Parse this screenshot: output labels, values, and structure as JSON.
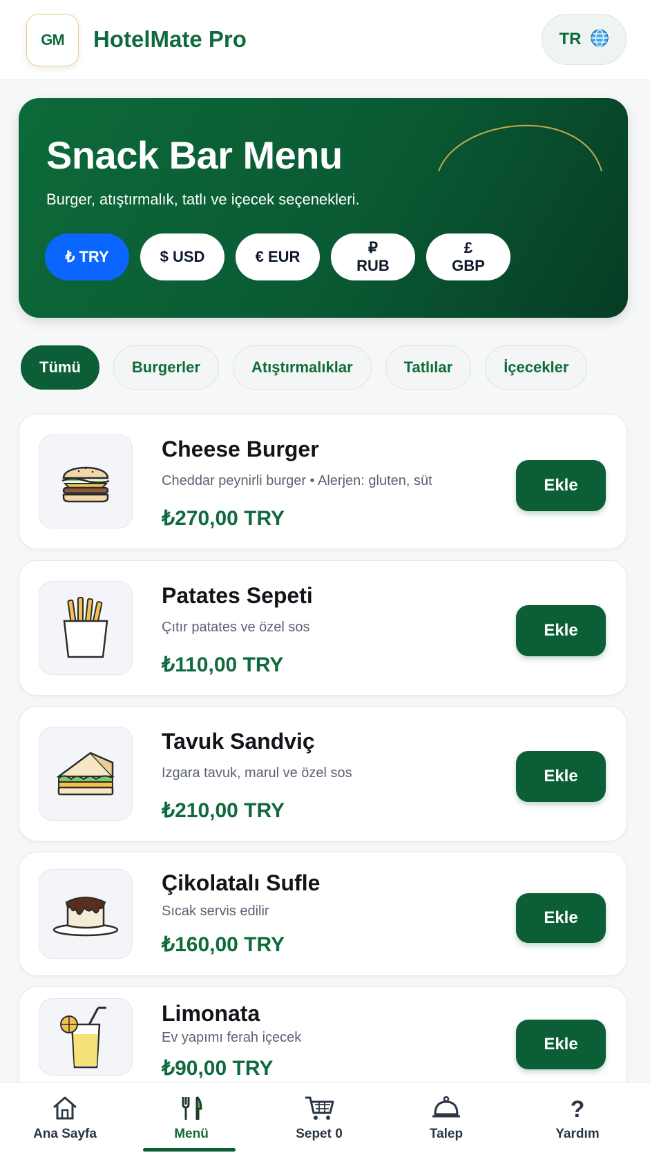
{
  "header": {
    "logo_text": "GM",
    "app_title": "HotelMate Pro",
    "language_code": "TR",
    "language_icon": "globe-icon"
  },
  "hero": {
    "title": "Snack Bar Menu",
    "subtitle": "Burger, atıştırmalık, tatlı ve içecek seçenekleri.",
    "currencies": [
      {
        "label": "₺ TRY",
        "active": true
      },
      {
        "label": "$ USD",
        "active": false
      },
      {
        "label": "€ EUR",
        "active": false
      },
      {
        "label": "₽ RUB",
        "active": false
      },
      {
        "label": "£ GBP",
        "active": false
      }
    ],
    "colors": {
      "background": "#0b5e36",
      "active_currency": "#0a66ff",
      "arc": "#c9a84a"
    }
  },
  "categories": [
    {
      "label": "Tümü",
      "active": true
    },
    {
      "label": "Burgerler",
      "active": false
    },
    {
      "label": "Atıştırmalıklar",
      "active": false
    },
    {
      "label": "Tatlılar",
      "active": false
    },
    {
      "label": "İçecekler",
      "active": false
    }
  ],
  "items": [
    {
      "name": "Cheese Burger",
      "description": "Cheddar peynirli burger • Alerjen: gluten, süt",
      "price": "₺270,00 TRY",
      "icon": "burger-icon",
      "button": "Ekle"
    },
    {
      "name": "Patates Sepeti",
      "description": "Çıtır patates ve özel sos",
      "price": "₺110,00 TRY",
      "icon": "fries-icon",
      "button": "Ekle"
    },
    {
      "name": "Tavuk Sandviç",
      "description": "Izgara tavuk, marul ve özel sos",
      "price": "₺210,00 TRY",
      "icon": "sandwich-icon",
      "button": "Ekle"
    },
    {
      "name": "Çikolatalı Sufle",
      "description": "Sıcak servis edilir",
      "price": "₺160,00 TRY",
      "icon": "souffle-icon",
      "button": "Ekle"
    },
    {
      "name": "Limonata",
      "description": "Ev yapımı ferah içecek",
      "price": "₺90,00 TRY",
      "icon": "lemonade-icon",
      "button": "Ekle"
    }
  ],
  "bottom_nav": [
    {
      "label": "Ana Sayfa",
      "icon": "home-icon",
      "active": false
    },
    {
      "label": "Menü",
      "icon": "fork-knife-icon",
      "active": true
    },
    {
      "label": "Sepet 0",
      "icon": "cart-icon",
      "active": false
    },
    {
      "label": "Talep",
      "icon": "service-bell-icon",
      "active": false
    },
    {
      "label": "Yardım",
      "icon": "question-icon",
      "active": false
    }
  ],
  "colors": {
    "brand_green": "#0f6b3d",
    "button_green": "#0b5e36"
  }
}
